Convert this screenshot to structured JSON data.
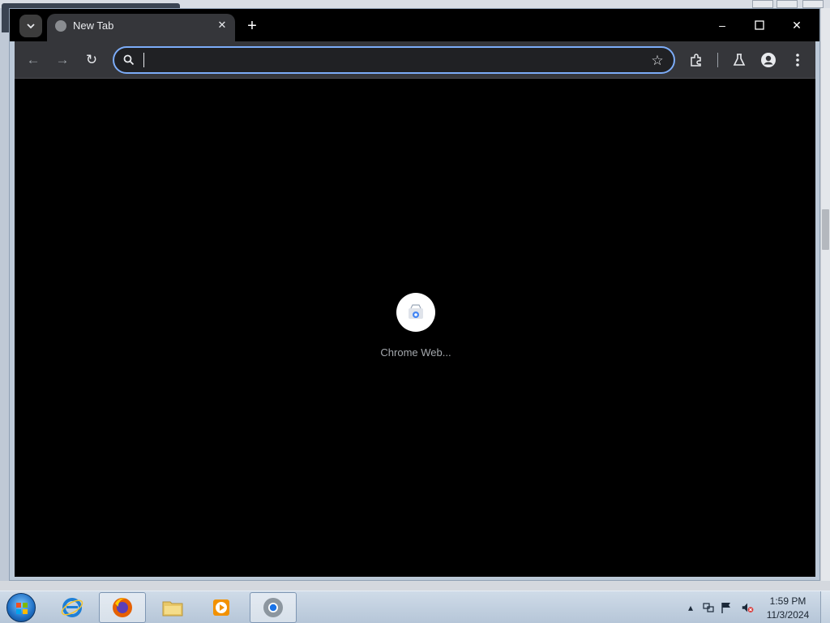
{
  "browser": {
    "tab": {
      "title": "New Tab"
    },
    "omnibox": {
      "value": "",
      "placeholder": ""
    },
    "shortcut": {
      "label": "Chrome Web..."
    }
  },
  "icons": [
    "tab-search-icon",
    "globe-icon",
    "close-icon",
    "plus-icon",
    "minimize-icon",
    "maximize-icon",
    "back-arrow-icon",
    "forward-arrow-icon",
    "reload-icon",
    "search-icon",
    "star-icon",
    "extensions-icon",
    "labs-flask-icon",
    "profile-icon",
    "kebab-menu-icon",
    "web-store-icon"
  ],
  "taskbar": {
    "apps": [
      "internet-explorer",
      "firefox",
      "file-explorer",
      "media-player",
      "chrome"
    ],
    "active_app": "chrome",
    "clock": {
      "time": "1:59 PM",
      "date": "11/3/2024"
    }
  },
  "colors": {
    "focus_ring": "#7cacf8",
    "page_background": "#000000",
    "toolbar": "#35363a"
  }
}
